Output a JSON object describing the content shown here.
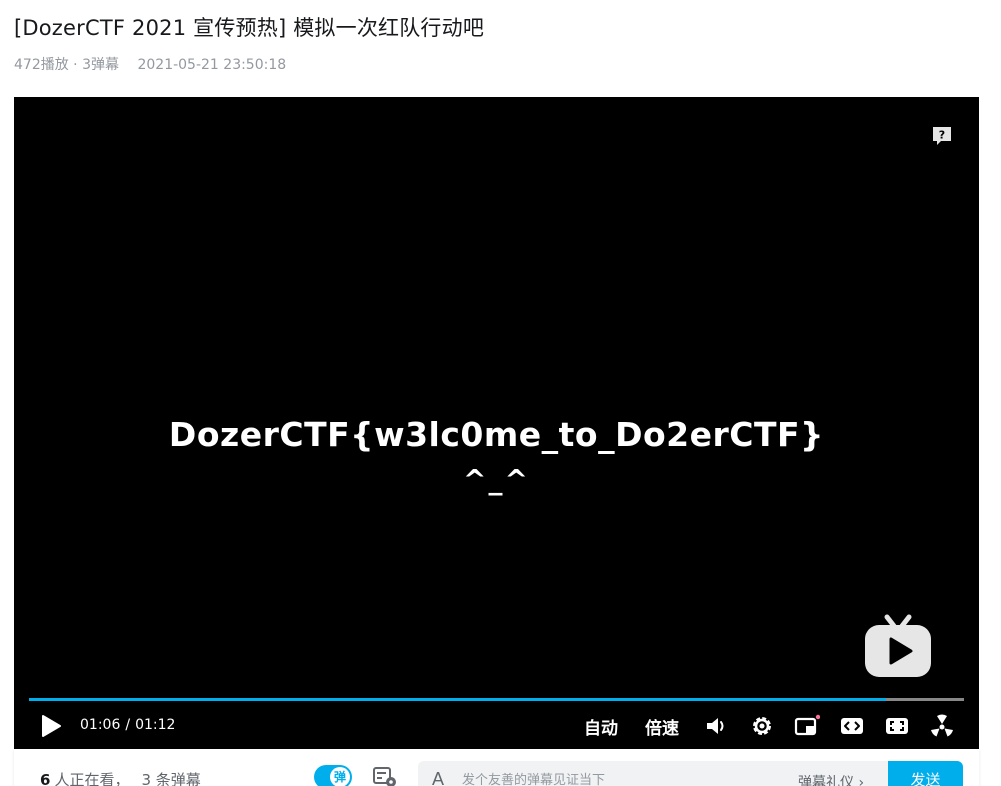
{
  "video": {
    "title": "[DozerCTF 2021 宣传预热] 模拟一次红队行动吧",
    "plays": "472播放",
    "separator": " · ",
    "danmaku_count": "3弹幕",
    "date": "2021-05-21 23:50:18"
  },
  "player": {
    "frame_text_line1": "DozerCTF{w3lc0me_to_Do2erCTF}",
    "frame_text_line2": "^_^",
    "progress_fraction": 0.917,
    "buffer_fraction": 1.0,
    "current_time": "01:06",
    "time_separator": "/",
    "total_time": "01:12",
    "controls": {
      "auto_label": "自动",
      "speed_label": "倍速"
    },
    "accent_color": "#00aeec",
    "icons": [
      "help-icon",
      "tv-logo-icon",
      "play-icon",
      "volume-icon",
      "settings-icon",
      "pip-icon",
      "widescreen-icon",
      "web-fullscreen-icon",
      "fullscreen-icon"
    ]
  },
  "bottom": {
    "viewer_count": "6",
    "viewer_suffix": "人正在看，",
    "danmaku_total": "3 条弹幕",
    "danmaku_toggle_label": "弹",
    "font_icon": "A",
    "input_placeholder": "发个友善的弹幕见证当下",
    "etiquette_label": "弹幕礼仪 ›",
    "send_label": "发送"
  }
}
